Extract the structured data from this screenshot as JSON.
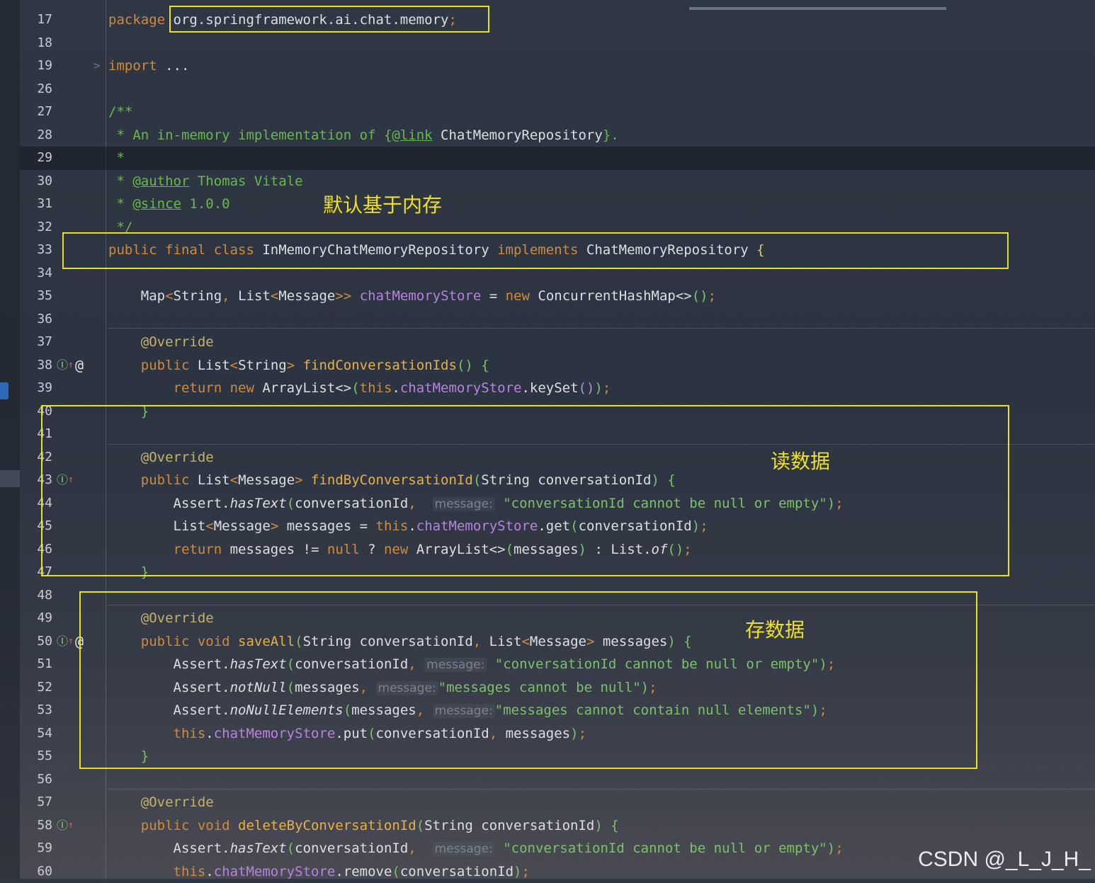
{
  "lines": [
    {
      "n": "17",
      "tokens": [
        [
          "k",
          "package "
        ],
        [
          "p",
          "org.springframework.ai.chat.memory"
        ],
        [
          "k",
          ";"
        ]
      ]
    },
    {
      "n": "18",
      "tokens": []
    },
    {
      "n": "19",
      "fold": ">",
      "tokens": [
        [
          "k",
          "import "
        ],
        [
          "p",
          "..."
        ]
      ]
    },
    {
      "n": "26",
      "tokens": []
    },
    {
      "n": "27",
      "tokens": [
        [
          "cm",
          "/**"
        ]
      ]
    },
    {
      "n": "28",
      "tokens": [
        [
          "cm",
          " * An in-memory implementation of "
        ],
        [
          "cm",
          "{"
        ],
        [
          "cmtag",
          "@link"
        ],
        [
          "p",
          " ChatMemoryRepository"
        ],
        [
          "cm",
          "}."
        ]
      ]
    },
    {
      "n": "29",
      "active": true,
      "tokens": [
        [
          "cm",
          " *"
        ]
      ]
    },
    {
      "n": "30",
      "tokens": [
        [
          "cm",
          " * "
        ],
        [
          "cmtag",
          "@author"
        ],
        [
          "cm",
          " Thomas Vitale"
        ]
      ]
    },
    {
      "n": "31",
      "tokens": [
        [
          "cm",
          " * "
        ],
        [
          "cmtag",
          "@since"
        ],
        [
          "cm",
          " 1.0.0"
        ]
      ]
    },
    {
      "n": "32",
      "tokens": [
        [
          "cm",
          " */"
        ]
      ]
    },
    {
      "n": "33",
      "tokens": [
        [
          "k",
          "public final class "
        ],
        [
          "ty",
          "InMemoryChatMemoryRepository "
        ],
        [
          "k",
          "implements "
        ],
        [
          "ty",
          "ChatMemoryRepository "
        ],
        [
          "br1",
          "{"
        ]
      ]
    },
    {
      "n": "34",
      "tokens": []
    },
    {
      "n": "35",
      "tokens": [
        [
          "p",
          "    Map"
        ],
        [
          "k",
          "<"
        ],
        [
          "p",
          "String"
        ],
        [
          "k",
          ", "
        ],
        [
          "p",
          "List"
        ],
        [
          "k",
          "<"
        ],
        [
          "p",
          "Message"
        ],
        [
          "k",
          ">> "
        ],
        [
          "fld",
          "chatMemoryStore"
        ],
        [
          "p",
          " = "
        ],
        [
          "k",
          "new "
        ],
        [
          "p",
          "ConcurrentHashMap<>"
        ],
        [
          "br2",
          "()"
        ],
        [
          "k",
          ";"
        ]
      ]
    },
    {
      "n": "36",
      "tokens": []
    },
    {
      "n": "37",
      "tokens": [
        [
          "an",
          "    @Override"
        ]
      ]
    },
    {
      "n": "38",
      "icon": true,
      "at": true,
      "tokens": [
        [
          "k",
          "    public "
        ],
        [
          "p",
          "List"
        ],
        [
          "k",
          "<"
        ],
        [
          "p",
          "String"
        ],
        [
          "k",
          "> "
        ],
        [
          "fn",
          "findConversationIds"
        ],
        [
          "br2",
          "() "
        ],
        [
          "br2",
          "{"
        ]
      ]
    },
    {
      "n": "39",
      "tokens": [
        [
          "k",
          "        return new "
        ],
        [
          "p",
          "ArrayList<>"
        ],
        [
          "br2",
          "("
        ],
        [
          "k",
          "this"
        ],
        [
          "p",
          "."
        ],
        [
          "fld",
          "chatMemoryStore"
        ],
        [
          "p",
          ".keySet"
        ],
        [
          "br3",
          "()"
        ],
        [
          "br2",
          ")"
        ],
        [
          "k",
          ";"
        ]
      ]
    },
    {
      "n": "40",
      "tokens": [
        [
          "br2",
          "    }"
        ]
      ]
    },
    {
      "n": "41",
      "tokens": []
    },
    {
      "n": "42",
      "tokens": [
        [
          "an",
          "    @Override"
        ]
      ]
    },
    {
      "n": "43",
      "icon": true,
      "tokens": [
        [
          "k",
          "    public "
        ],
        [
          "p",
          "List"
        ],
        [
          "k",
          "<"
        ],
        [
          "p",
          "Message"
        ],
        [
          "k",
          "> "
        ],
        [
          "fn",
          "findByConversationId"
        ],
        [
          "br2",
          "("
        ],
        [
          "p",
          "String conversationId"
        ],
        [
          "br2",
          ") "
        ],
        [
          "br2",
          "{"
        ]
      ]
    },
    {
      "n": "44",
      "tokens": [
        [
          "p",
          "        Assert."
        ],
        [
          "it",
          "hasText"
        ],
        [
          "br2",
          "("
        ],
        [
          "p",
          "conversationId"
        ],
        [
          "k",
          ",  "
        ],
        [
          "hint",
          "message:"
        ],
        [
          "str",
          " \"conversationId cannot be null or empty\""
        ],
        [
          "br2",
          ")"
        ],
        [
          "k",
          ";"
        ]
      ]
    },
    {
      "n": "45",
      "tokens": [
        [
          "p",
          "        List"
        ],
        [
          "k",
          "<"
        ],
        [
          "p",
          "Message"
        ],
        [
          "k",
          "> "
        ],
        [
          "p",
          "messages = "
        ],
        [
          "k",
          "this"
        ],
        [
          "p",
          "."
        ],
        [
          "fld",
          "chatMemoryStore"
        ],
        [
          "p",
          ".get"
        ],
        [
          "br2",
          "("
        ],
        [
          "p",
          "conversationId"
        ],
        [
          "br2",
          ")"
        ],
        [
          "k",
          ";"
        ]
      ]
    },
    {
      "n": "46",
      "tokens": [
        [
          "k",
          "        return "
        ],
        [
          "p",
          "messages != "
        ],
        [
          "k",
          "null "
        ],
        [
          "p",
          "? "
        ],
        [
          "k",
          "new "
        ],
        [
          "p",
          "ArrayList<>"
        ],
        [
          "br2",
          "("
        ],
        [
          "p",
          "messages"
        ],
        [
          "br2",
          ") "
        ],
        [
          "p",
          ": List."
        ],
        [
          "it",
          "of"
        ],
        [
          "br2",
          "()"
        ],
        [
          "k",
          ";"
        ]
      ]
    },
    {
      "n": "47",
      "tokens": [
        [
          "br2",
          "    }"
        ]
      ]
    },
    {
      "n": "48",
      "tokens": []
    },
    {
      "n": "49",
      "tokens": [
        [
          "an",
          "    @Override"
        ]
      ]
    },
    {
      "n": "50",
      "icon": true,
      "at": true,
      "tokens": [
        [
          "k",
          "    public void "
        ],
        [
          "fn",
          "saveAll"
        ],
        [
          "br2",
          "("
        ],
        [
          "p",
          "String conversationId"
        ],
        [
          "k",
          ", "
        ],
        [
          "p",
          "List"
        ],
        [
          "k",
          "<"
        ],
        [
          "p",
          "Message"
        ],
        [
          "k",
          "> "
        ],
        [
          "p",
          "messages"
        ],
        [
          "br2",
          ") "
        ],
        [
          "br2",
          "{"
        ]
      ]
    },
    {
      "n": "51",
      "tokens": [
        [
          "p",
          "        Assert."
        ],
        [
          "it",
          "hasText"
        ],
        [
          "br2",
          "("
        ],
        [
          "p",
          "conversationId"
        ],
        [
          "k",
          ", "
        ],
        [
          "hint",
          "message:"
        ],
        [
          "str",
          " \"conversationId cannot be null or empty\""
        ],
        [
          "br2",
          ")"
        ],
        [
          "k",
          ";"
        ]
      ]
    },
    {
      "n": "52",
      "tokens": [
        [
          "p",
          "        Assert."
        ],
        [
          "it",
          "notNull"
        ],
        [
          "br2",
          "("
        ],
        [
          "p",
          "messages"
        ],
        [
          "k",
          ", "
        ],
        [
          "hint",
          "message:"
        ],
        [
          "str",
          "\"messages cannot be null\""
        ],
        [
          "br2",
          ")"
        ],
        [
          "k",
          ";"
        ]
      ]
    },
    {
      "n": "53",
      "tokens": [
        [
          "p",
          "        Assert."
        ],
        [
          "it",
          "noNullElements"
        ],
        [
          "br2",
          "("
        ],
        [
          "p",
          "messages"
        ],
        [
          "k",
          ", "
        ],
        [
          "hint",
          "message:"
        ],
        [
          "str",
          "\"messages cannot contain null elements\""
        ],
        [
          "br2",
          ")"
        ],
        [
          "k",
          ";"
        ]
      ]
    },
    {
      "n": "54",
      "tokens": [
        [
          "k",
          "        this"
        ],
        [
          "p",
          "."
        ],
        [
          "fld",
          "chatMemoryStore"
        ],
        [
          "p",
          ".put"
        ],
        [
          "br2",
          "("
        ],
        [
          "p",
          "conversationId"
        ],
        [
          "k",
          ", "
        ],
        [
          "p",
          "messages"
        ],
        [
          "br2",
          ")"
        ],
        [
          "k",
          ";"
        ]
      ]
    },
    {
      "n": "55",
      "tokens": [
        [
          "br2",
          "    }"
        ]
      ]
    },
    {
      "n": "56",
      "tokens": []
    },
    {
      "n": "57",
      "tokens": [
        [
          "an",
          "    @Override"
        ]
      ]
    },
    {
      "n": "58",
      "icon": true,
      "tokens": [
        [
          "k",
          "    public void "
        ],
        [
          "fn",
          "deleteByConversationId"
        ],
        [
          "br2",
          "("
        ],
        [
          "p",
          "String conversationId"
        ],
        [
          "br2",
          ") "
        ],
        [
          "br2",
          "{"
        ]
      ]
    },
    {
      "n": "59",
      "tokens": [
        [
          "p",
          "        Assert."
        ],
        [
          "it",
          "hasText"
        ],
        [
          "br2",
          "("
        ],
        [
          "p",
          "conversationId"
        ],
        [
          "k",
          ",  "
        ],
        [
          "hint",
          "message:"
        ],
        [
          "str",
          " \"conversationId cannot be null or empty\""
        ],
        [
          "br2",
          ")"
        ],
        [
          "k",
          ";"
        ]
      ]
    },
    {
      "n": "60",
      "tokens": [
        [
          "k",
          "        this"
        ],
        [
          "p",
          "."
        ],
        [
          "fld",
          "chatMemoryStore"
        ],
        [
          "p",
          ".remove"
        ],
        [
          "br2",
          "("
        ],
        [
          "p",
          "conversationId"
        ],
        [
          "br2",
          ")"
        ],
        [
          "k",
          ";"
        ]
      ]
    }
  ],
  "annotations": {
    "default_memory": "默认基于内存",
    "read_data": "读数据",
    "save_data": "存数据"
  },
  "gutter_icon_glyph": "Ⓘ",
  "gutter_icon_arrow": "↑",
  "gutter_at_glyph": "@",
  "watermark": "CSDN @_L_J_H_",
  "colors": {
    "highlight_box": "#e8e020",
    "keyword": "#d08a3e",
    "comment": "#69b84e",
    "method": "#e6b04a",
    "field": "#b882e0",
    "string": "#7cc26a"
  }
}
